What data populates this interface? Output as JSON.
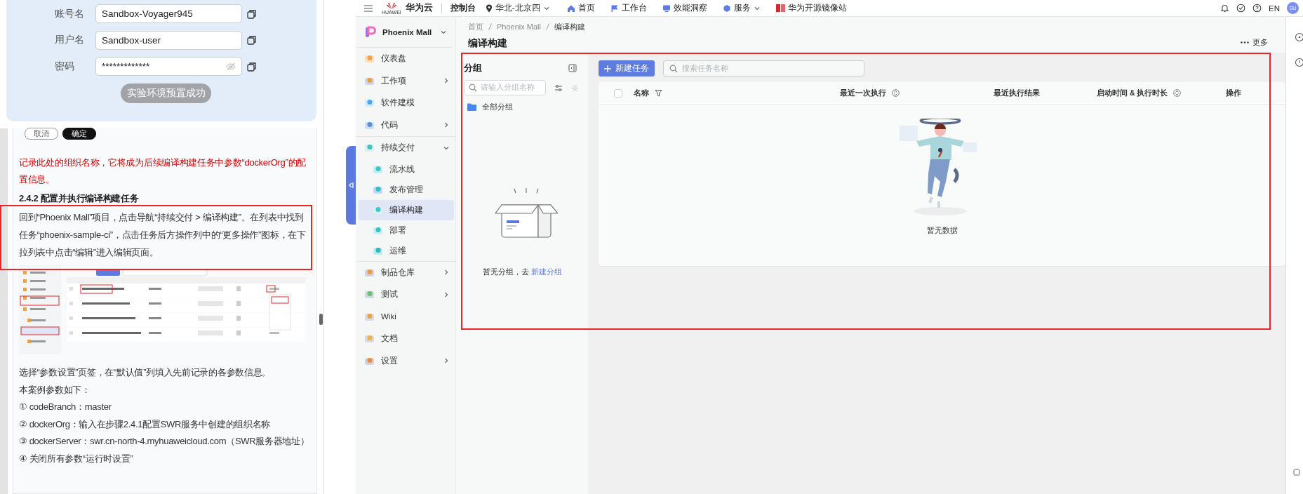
{
  "guide": {
    "credentials": [
      {
        "label": "账号名",
        "value": "Sandbox-Voyager945",
        "kind": "text"
      },
      {
        "label": "用户名",
        "value": "Sandbox-user",
        "kind": "text"
      },
      {
        "label": "密码",
        "value": "*************",
        "kind": "password",
        "revealed": false
      }
    ],
    "status_button": {
      "label": "实验环境预置成功",
      "disabled": true
    },
    "dialog_buttons": [
      {
        "label": "取消",
        "kind": "secondary"
      },
      {
        "label": "确定",
        "kind": "primary"
      }
    ],
    "blocks": [
      {
        "kind": "note",
        "text": "记录此处的组织名称，它将成为后续编译构建任务中参数“dockerOrg”的配置信息。"
      },
      {
        "kind": "heading",
        "text": "2.4.2 配置并执行编译构建任务"
      },
      {
        "kind": "paragraph",
        "text": "回到“Phoenix Mall”项目，点击导航“持续交付 > 编译构建”。在列表中找到任务“phoenix-sample-ci”，点击任务后方操作列中的“更多操作”图标，在下拉列表中点击“编辑”进入编辑页面。",
        "highlighted": true
      },
      {
        "kind": "screenshot"
      },
      {
        "kind": "paragraph",
        "text": "选择“参数设置”页签，在“默认值”列填入先前记录的各参数信息。",
        "highlighted": false
      },
      {
        "kind": "paragraph",
        "text": "本案例参数如下：",
        "highlighted": false
      },
      {
        "kind": "paragraph",
        "text": "① codeBranch：master",
        "highlighted": false
      },
      {
        "kind": "paragraph",
        "text": "② dockerOrg：输入在步骤2.4.1配置SWR服务中创建的组织名称",
        "highlighted": false
      },
      {
        "kind": "paragraph",
        "text": "③ dockerServer：swr.cn-north-4.myhuaweicloud.com（SWR服务器地址）",
        "highlighted": false
      },
      {
        "kind": "paragraph",
        "text": "④ 关闭所有参数“运行时设置”",
        "highlighted": false
      }
    ]
  },
  "topbar": {
    "logo_caption": "HUAWEI",
    "brand": "华为云",
    "console": "控制台",
    "region": "华北-北京四",
    "nav": [
      {
        "label": "首页",
        "dropdown": false
      },
      {
        "label": "工作台",
        "dropdown": false
      },
      {
        "label": "效能洞察",
        "dropdown": false
      },
      {
        "label": "服务",
        "dropdown": true
      },
      {
        "label": "华为开源镜像站",
        "dropdown": false
      }
    ],
    "language": "EN",
    "avatar": "SU"
  },
  "sidebar": {
    "project": "Phoenix Mall",
    "items": [
      {
        "label": "仪表盘",
        "kind": "link",
        "selected": false
      },
      {
        "label": "工作项",
        "kind": "group",
        "expanded": false,
        "selected": false
      },
      {
        "label": "软件建模",
        "kind": "link",
        "selected": false
      },
      {
        "label": "代码",
        "kind": "group",
        "expanded": false,
        "selected": false
      },
      {
        "label": "持续交付",
        "kind": "group",
        "expanded": true,
        "selected": false,
        "children": [
          {
            "label": "流水线",
            "selected": false
          },
          {
            "label": "发布管理",
            "selected": false
          },
          {
            "label": "编译构建",
            "selected": true
          },
          {
            "label": "部署",
            "selected": false
          },
          {
            "label": "运维",
            "selected": false
          }
        ]
      },
      {
        "label": "制品仓库",
        "kind": "group",
        "expanded": false,
        "selected": false
      },
      {
        "label": "测试",
        "kind": "group",
        "expanded": false,
        "selected": false
      },
      {
        "label": "Wiki",
        "kind": "link",
        "selected": false
      },
      {
        "label": "文档",
        "kind": "link",
        "selected": false
      },
      {
        "label": "设置",
        "kind": "group",
        "expanded": false,
        "selected": false
      }
    ]
  },
  "page": {
    "breadcrumb": [
      "首页",
      "Phoenix Mall",
      "编译构建"
    ],
    "title": "编译构建",
    "more_button": "更多",
    "highlighted": true,
    "groups": {
      "title": "分组",
      "search_placeholder": "请输入分组名称",
      "items": [
        {
          "label": "全部分组"
        }
      ],
      "empty_text": "暂无分组，去",
      "empty_link": "新建分组"
    },
    "tasks": {
      "new_button": "新建任务",
      "search_placeholder": "搜索任务名称",
      "select_all_checked": false,
      "columns": [
        {
          "label": "名称"
        },
        {
          "label": "最近一次执行"
        },
        {
          "label": "最近执行结果"
        },
        {
          "label": "启动时间 & 执行时长"
        },
        {
          "label": "操作"
        }
      ],
      "empty_text": "暂无数据"
    }
  }
}
